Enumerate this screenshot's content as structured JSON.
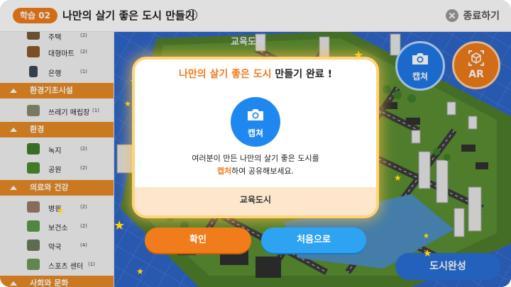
{
  "header": {
    "step_badge": "학습 02",
    "title": "나만의 살기 좋은 도시 만들기",
    "exit_label": "종료하기"
  },
  "sidebar": {
    "items_top": [
      {
        "label": "주택",
        "count": "(2)"
      },
      {
        "label": "대형마트",
        "count": "(2)"
      },
      {
        "label": "은행",
        "count": "(1)"
      }
    ],
    "categories": [
      {
        "label": "환경기초시설",
        "items": [
          {
            "label": "쓰레기 매립장",
            "count": "(1)"
          }
        ]
      },
      {
        "label": "환경",
        "items": [
          {
            "label": "녹지",
            "count": "(2)"
          },
          {
            "label": "공원",
            "count": "(2)"
          }
        ]
      },
      {
        "label": "의료와 건강",
        "items": [
          {
            "label": "병원",
            "count": "(2)"
          },
          {
            "label": "보건소",
            "count": "(2)"
          },
          {
            "label": "약국",
            "count": "(4)"
          },
          {
            "label": "스포츠 센터",
            "count": "(1)"
          }
        ]
      },
      {
        "label": "사회와 문화",
        "items": []
      }
    ]
  },
  "city": {
    "name_label": "교육도시"
  },
  "right_panel": {
    "capture_label": "캡쳐",
    "ar_label": "AR",
    "complete_label": "도시완성"
  },
  "modal": {
    "title_highlight": "나만의 살기 좋은 도시",
    "title_rest": " 만들기 완료 !",
    "camera_label": "캡쳐",
    "message_line1": "여러분이 만든 나만의 살기 좋은 도시를",
    "message_line2_highlight": "캡처",
    "message_line2_rest": "하여 공유해보세요.",
    "footer_city": "교육도시",
    "confirm_label": "확인",
    "restart_label": "처음으로"
  },
  "colors": {
    "accent_orange": "#f07c1b",
    "accent_blue": "#1f88f0",
    "map_water": "#2f66c8",
    "grass": "#4e7d2c"
  }
}
